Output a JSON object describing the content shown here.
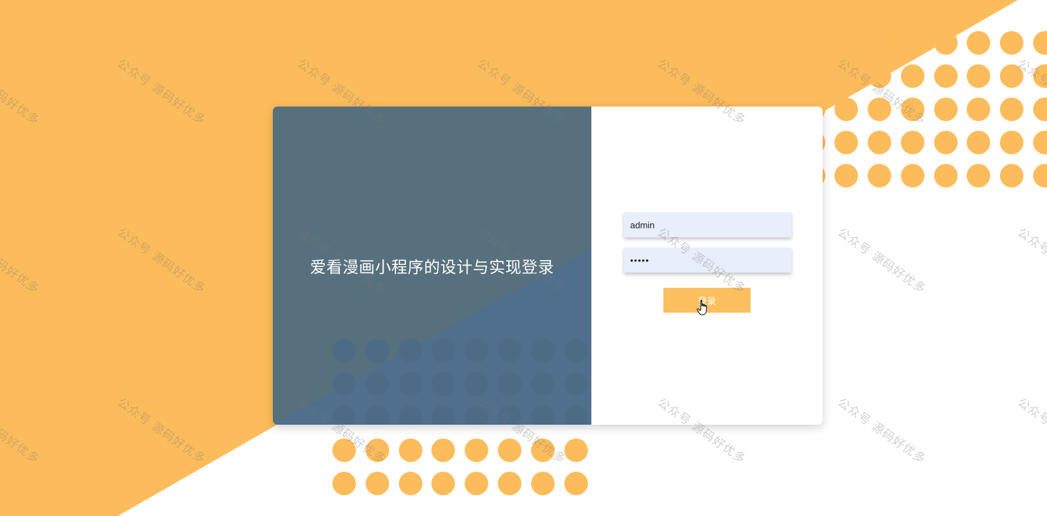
{
  "header": {
    "system_title": "爱看漫画小程序的设计与实现登录"
  },
  "login_form": {
    "username_value": "admin",
    "password_value": "•••••",
    "login_button_label": "登录"
  },
  "watermark": {
    "text": "公众号 源码好优多"
  },
  "colors": {
    "accent_orange": "#fbbf5f",
    "panel_slate": "#57707d",
    "input_bg": "#e8eefb"
  },
  "icons": {
    "cursor": "hand-pointer-icon"
  }
}
